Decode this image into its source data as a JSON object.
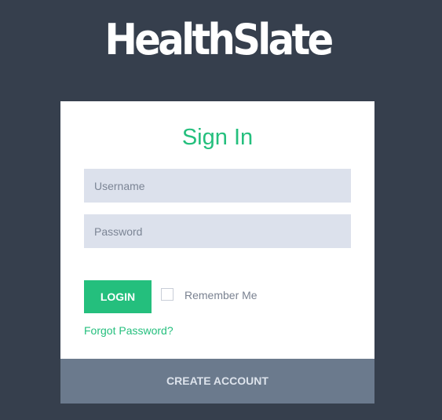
{
  "brand": {
    "name": "HealthSlate"
  },
  "login_form": {
    "title": "Sign In",
    "username_placeholder": "Username",
    "password_placeholder": "Password",
    "login_label": "LOGIN",
    "remember_me_label": "Remember Me",
    "remember_me_checked": false,
    "forgot_password_label": "Forgot Password?"
  },
  "footer": {
    "create_account_label": "CREATE ACCOUNT"
  },
  "colors": {
    "background": "#363f4d",
    "accent": "#24bf7d",
    "input_fill": "#dce1ec",
    "footer_bar": "#6b7a8d"
  }
}
